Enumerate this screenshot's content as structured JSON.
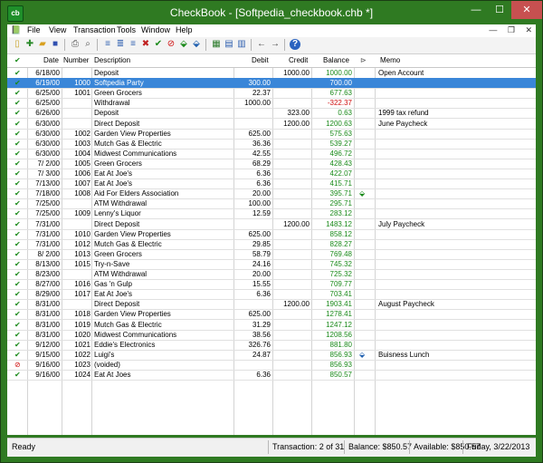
{
  "window": {
    "title": "CheckBook - [Softpedia_checkbook.chb *]",
    "app_icon_text": "cb",
    "min": "—",
    "max": "☐",
    "close": "✕"
  },
  "menu": [
    "File",
    "View",
    "Transaction",
    "Tools",
    "Window",
    "Help"
  ],
  "mdi": {
    "min": "—",
    "restore": "❐",
    "close": "✕"
  },
  "columns": {
    "check": "✔",
    "date": "Date",
    "number": "Number",
    "description": "Description",
    "debit": "Debit",
    "credit": "Credit",
    "balance": "Balance",
    "tag": "⊳",
    "memo": "Memo"
  },
  "rows": [
    {
      "s": "check",
      "date": "6/18/00",
      "number": "",
      "desc": "Deposit",
      "debit": "",
      "credit": "1000.00",
      "balance": "1000.00",
      "bal": "pos",
      "tag": "",
      "memo": "Open Account"
    },
    {
      "s": "check",
      "date": "6/19/00",
      "number": "1000",
      "desc": "Softpedia Party",
      "debit": "300.00",
      "credit": "",
      "balance": "700.00",
      "bal": "pos",
      "tag": "",
      "memo": ""
    },
    {
      "s": "check",
      "date": "6/25/00",
      "number": "1001",
      "desc": "Green Grocers",
      "debit": "22.37",
      "credit": "",
      "balance": "677.63",
      "bal": "pos",
      "tag": "",
      "memo": ""
    },
    {
      "s": "check",
      "date": "6/25/00",
      "number": "",
      "desc": "Withdrawal",
      "debit": "1000.00",
      "credit": "",
      "balance": "-322.37",
      "bal": "neg",
      "tag": "",
      "memo": ""
    },
    {
      "s": "check",
      "date": "6/26/00",
      "number": "",
      "desc": "Deposit",
      "debit": "",
      "credit": "323.00",
      "balance": "0.63",
      "bal": "pos",
      "tag": "",
      "memo": "1999 tax refund"
    },
    {
      "s": "check",
      "date": "6/30/00",
      "number": "",
      "desc": "Direct Deposit",
      "debit": "",
      "credit": "1200.00",
      "balance": "1200.63",
      "bal": "pos",
      "tag": "",
      "memo": "June Paycheck"
    },
    {
      "s": "check",
      "date": "6/30/00",
      "number": "1002",
      "desc": "Garden View Properties",
      "debit": "625.00",
      "credit": "",
      "balance": "575.63",
      "bal": "pos",
      "tag": "",
      "memo": ""
    },
    {
      "s": "check",
      "date": "6/30/00",
      "number": "1003",
      "desc": "Mutch Gas & Electric",
      "debit": "36.36",
      "credit": "",
      "balance": "539.27",
      "bal": "pos",
      "tag": "",
      "memo": ""
    },
    {
      "s": "check",
      "date": "6/30/00",
      "number": "1004",
      "desc": "Midwest Communications",
      "debit": "42.55",
      "credit": "",
      "balance": "496.72",
      "bal": "pos",
      "tag": "",
      "memo": ""
    },
    {
      "s": "check",
      "date": "7/ 2/00",
      "number": "1005",
      "desc": "Green Grocers",
      "debit": "68.29",
      "credit": "",
      "balance": "428.43",
      "bal": "pos",
      "tag": "",
      "memo": ""
    },
    {
      "s": "check",
      "date": "7/ 3/00",
      "number": "1006",
      "desc": "Eat At Joe's",
      "debit": "6.36",
      "credit": "",
      "balance": "422.07",
      "bal": "pos",
      "tag": "",
      "memo": ""
    },
    {
      "s": "check",
      "date": "7/13/00",
      "number": "1007",
      "desc": "Eat At Joe's",
      "debit": "6.36",
      "credit": "",
      "balance": "415.71",
      "bal": "pos",
      "tag": "",
      "memo": ""
    },
    {
      "s": "check",
      "date": "7/18/00",
      "number": "1008",
      "desc": "Aid For Elders Association",
      "debit": "20.00",
      "credit": "",
      "balance": "395.71",
      "bal": "pos",
      "tag": "green",
      "memo": ""
    },
    {
      "s": "check",
      "date": "7/25/00",
      "number": "",
      "desc": "ATM Withdrawal",
      "debit": "100.00",
      "credit": "",
      "balance": "295.71",
      "bal": "pos",
      "tag": "",
      "memo": ""
    },
    {
      "s": "check",
      "date": "7/25/00",
      "number": "1009",
      "desc": "Lenny's Liquor",
      "debit": "12.59",
      "credit": "",
      "balance": "283.12",
      "bal": "pos",
      "tag": "",
      "memo": ""
    },
    {
      "s": "check",
      "date": "7/31/00",
      "number": "",
      "desc": "Direct Deposit",
      "debit": "",
      "credit": "1200.00",
      "balance": "1483.12",
      "bal": "pos",
      "tag": "",
      "memo": "July Paycheck"
    },
    {
      "s": "check",
      "date": "7/31/00",
      "number": "1010",
      "desc": "Garden View Properties",
      "debit": "625.00",
      "credit": "",
      "balance": "858.12",
      "bal": "pos",
      "tag": "",
      "memo": ""
    },
    {
      "s": "check",
      "date": "7/31/00",
      "number": "1012",
      "desc": "Mutch Gas & Electric",
      "debit": "29.85",
      "credit": "",
      "balance": "828.27",
      "bal": "pos",
      "tag": "",
      "memo": ""
    },
    {
      "s": "check",
      "date": "8/ 2/00",
      "number": "1013",
      "desc": "Green Grocers",
      "debit": "58.79",
      "credit": "",
      "balance": "769.48",
      "bal": "pos",
      "tag": "",
      "memo": ""
    },
    {
      "s": "check",
      "date": "8/13/00",
      "number": "1015",
      "desc": "Try-n-Save",
      "debit": "24.16",
      "credit": "",
      "balance": "745.32",
      "bal": "pos",
      "tag": "",
      "memo": ""
    },
    {
      "s": "check",
      "date": "8/23/00",
      "number": "",
      "desc": "ATM Withdrawal",
      "debit": "20.00",
      "credit": "",
      "balance": "725.32",
      "bal": "pos",
      "tag": "",
      "memo": ""
    },
    {
      "s": "check",
      "date": "8/27/00",
      "number": "1016",
      "desc": "Gas 'n Gulp",
      "debit": "15.55",
      "credit": "",
      "balance": "709.77",
      "bal": "pos",
      "tag": "",
      "memo": ""
    },
    {
      "s": "check",
      "date": "8/29/00",
      "number": "1017",
      "desc": "Eat At Joe's",
      "debit": "6.36",
      "credit": "",
      "balance": "703.41",
      "bal": "pos",
      "tag": "",
      "memo": ""
    },
    {
      "s": "check",
      "date": "8/31/00",
      "number": "",
      "desc": "Direct Deposit",
      "debit": "",
      "credit": "1200.00",
      "balance": "1903.41",
      "bal": "pos",
      "tag": "",
      "memo": "August Paycheck"
    },
    {
      "s": "check",
      "date": "8/31/00",
      "number": "1018",
      "desc": "Garden View Properties",
      "debit": "625.00",
      "credit": "",
      "balance": "1278.41",
      "bal": "pos",
      "tag": "",
      "memo": ""
    },
    {
      "s": "check",
      "date": "8/31/00",
      "number": "1019",
      "desc": "Mutch Gas & Electric",
      "debit": "31.29",
      "credit": "",
      "balance": "1247.12",
      "bal": "pos",
      "tag": "",
      "memo": ""
    },
    {
      "s": "check",
      "date": "8/31/00",
      "number": "1020",
      "desc": "Midwest Communications",
      "debit": "38.56",
      "credit": "",
      "balance": "1208.56",
      "bal": "pos",
      "tag": "",
      "memo": ""
    },
    {
      "s": "check",
      "date": "9/12/00",
      "number": "1021",
      "desc": "Eddie's Electronics",
      "debit": "326.76",
      "credit": "",
      "balance": "881.80",
      "bal": "pos",
      "tag": "",
      "memo": ""
    },
    {
      "s": "check",
      "date": "9/15/00",
      "number": "1022",
      "desc": "Luigi's",
      "debit": "24.87",
      "credit": "",
      "balance": "856.93",
      "bal": "pos",
      "tag": "blue",
      "memo": "Buisness Lunch"
    },
    {
      "s": "void",
      "date": "9/16/00",
      "number": "1023",
      "desc": "(voided)",
      "debit": "",
      "credit": "",
      "balance": "856.93",
      "bal": "pos",
      "tag": "",
      "memo": ""
    },
    {
      "s": "check",
      "date": "9/16/00",
      "number": "1024",
      "desc": "Eat At Joes",
      "debit": "6.36",
      "credit": "",
      "balance": "850.57",
      "bal": "pos",
      "tag": "",
      "memo": ""
    }
  ],
  "selected_row": 1,
  "status": {
    "ready": "Ready",
    "transaction": "Transaction: 2 of 31",
    "balance": "Balance: $850.57",
    "available": "Available: $850.57",
    "date": "Friday, 3/22/2013"
  },
  "colors": {
    "title_bar": "#2f7a22",
    "selection": "#3a86d8",
    "positive": "#1a8a1a",
    "negative": "#d01010"
  }
}
